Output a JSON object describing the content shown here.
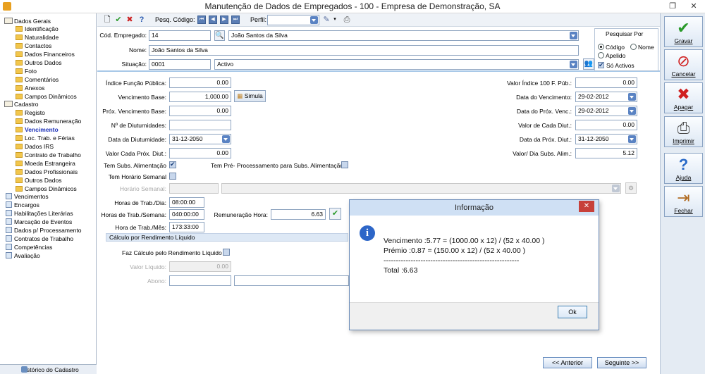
{
  "window": {
    "title": "Manutenção de Dados de Empregados - 100 - Empresa de Demonstração, SA"
  },
  "toolbar": {
    "pesq_codigo_label": "Pesq. Código:",
    "perfil_label": "Perfil:",
    "perfil_value": ""
  },
  "tree": {
    "items": [
      {
        "label": "Dados Gerais"
      },
      {
        "label": "Identificação"
      },
      {
        "label": "Naturalidade"
      },
      {
        "label": "Contactos"
      },
      {
        "label": "Dados Financeiros"
      },
      {
        "label": "Outros Dados"
      },
      {
        "label": "Foto"
      },
      {
        "label": "Comentários"
      },
      {
        "label": "Anexos"
      },
      {
        "label": "Campos Dinâmicos"
      },
      {
        "label": "Cadastro"
      },
      {
        "label": "Registo"
      },
      {
        "label": "Dados Remuneração"
      },
      {
        "label": "Vencimento"
      },
      {
        "label": "Loc. Trab. e Férias"
      },
      {
        "label": "Dados IRS"
      },
      {
        "label": "Contrato de Trabalho"
      },
      {
        "label": "Moeda Estrangeira"
      },
      {
        "label": "Dados Profissionais"
      },
      {
        "label": "Outros Dados"
      },
      {
        "label": "Campos Dinâmicos"
      },
      {
        "label": "Vencimentos"
      },
      {
        "label": "Encargos"
      },
      {
        "label": "Habilitações Literárias"
      },
      {
        "label": "Marcação de Eventos"
      },
      {
        "label": "Dados p/ Processamento"
      },
      {
        "label": "Contratos de Trabalho"
      },
      {
        "label": "Competências"
      },
      {
        "label": "Avaliação"
      }
    ],
    "history_label": "Histórico do Cadastro"
  },
  "header": {
    "cod_empregado_label": "Cód. Empregado:",
    "cod_empregado_value": "14",
    "cod_empregado_name": "João Santos da Silva",
    "nome_label": "Nome:",
    "nome_value": "João Santos da Silva",
    "situacao_label": "Situação:",
    "situacao_code": "0001",
    "situacao_value": "Activo",
    "pesquisar": {
      "title": "Pesquisar Por",
      "codigo": "Código",
      "nome": "Nome",
      "apelido": "Apelido",
      "so_activos": "Só Activos"
    }
  },
  "form": {
    "indice_label": "Índice Função Pública:",
    "indice_value": "0.00",
    "venc_base_label": "Vencimento Base:",
    "venc_base_value": "1,000.00",
    "simula_label": "Simula",
    "prox_venc_label": "Próx. Vencimento Base:",
    "prox_venc_value": "0.00",
    "n_diut_label": "Nº de Diuturnidades:",
    "n_diut_value": "",
    "data_diut_label": "Data da Diuturnidade:",
    "data_diut_value": "31-12-2050",
    "valor_prox_diut_label": "Valor Cada Próx. Diut.:",
    "valor_prox_diut_value": "0.00",
    "tem_subs_label": "Tem Subs. Alimentação",
    "tem_pre_label": "Tem Pré- Processamento para Subs. Alimentação",
    "tem_horario_label": "Tem Horário Semanal",
    "horario_semanal_label": "Horário Semanal:",
    "horas_dia_label": "Horas de Trab./Dia:",
    "horas_dia_value": "08:00:00",
    "horas_semana_label": "Horas de Trab./Semana:",
    "horas_semana_value": "040:00:00",
    "remuneracao_hora_label": "Remuneração Hora:",
    "remuneracao_hora_value": "6.63",
    "hora_mes_label": "Hora de Trab./Mês:",
    "hora_mes_value": "173:33:00",
    "calculo_group": "Cálculo por Rendimento Líquido",
    "faz_calculo_label": "Faz Cálculo pelo Rendimento Líquido",
    "valor_liquido_label": "Valor Líquido:",
    "valor_liquido_value": "0.00",
    "abono_label": "Abono:",
    "valor_indice_label": "Valor Índice 100 F.  Púb.:",
    "valor_indice_value": "0.00",
    "data_venc_label": "Data do Vencimento:",
    "data_venc_value": "29-02-2012",
    "data_prox_venc_label": "Data do Próx. Venc.:",
    "data_prox_venc_value": "29-02-2012",
    "valor_cada_diut_label": "Valor de Cada Diut.:",
    "valor_cada_diut_value": "0.00",
    "data_prox_diut_label": "Data da Próx. Diut.:",
    "data_prox_diut_value": "31-12-2050",
    "valor_dia_subs_label": "Valor/ Dia Subs. Alim.:",
    "valor_dia_subs_value": "5.12"
  },
  "footer": {
    "anterior": "<< Anterior",
    "seguinte": "Seguinte >>"
  },
  "actions": [
    {
      "label": "Gravar"
    },
    {
      "label": "Cancelar"
    },
    {
      "label": "Apagar"
    },
    {
      "label": "Imprimir"
    },
    {
      "label": "Ajuda"
    },
    {
      "label": "Fechar"
    }
  ],
  "dialog": {
    "title": "Informação",
    "line1": "Vencimento :5.77 = (1000.00 x 12) / (52 x 40.00 )",
    "line2": "Prémio :0.87 = (150.00 x 12) / (52 x 40.00 )",
    "line3": "-------------------------------------------------------",
    "line4": "Total :6.63",
    "ok": "Ok"
  },
  "colors": {
    "accent": "#5a83c3",
    "selected_tree": "#1a2fb8"
  }
}
